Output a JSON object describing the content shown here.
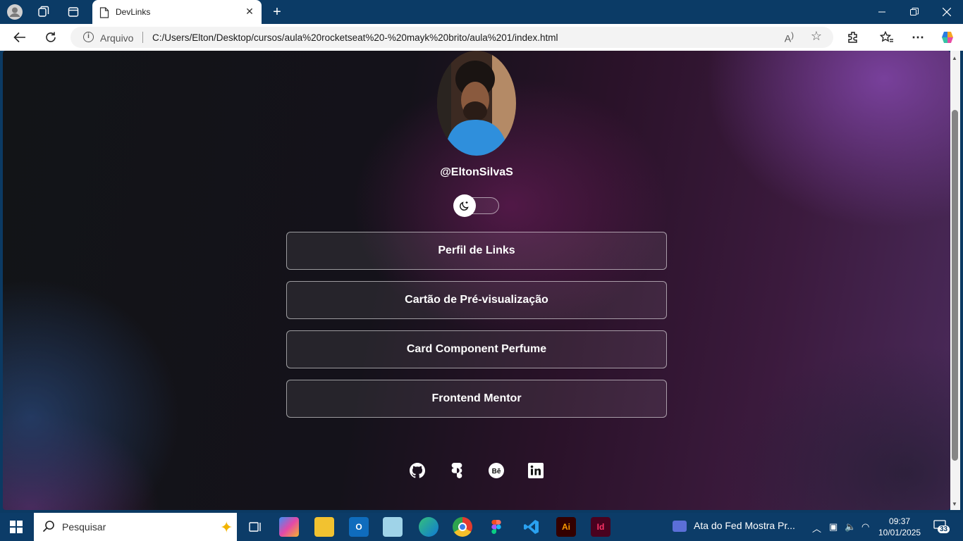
{
  "browser": {
    "tab_title": "DevLinks",
    "new_tab": "+",
    "address_prefix": "Arquivo",
    "url": "C:/Users/Elton/Desktop/cursos/aula%20rocketseat%20-%20mayk%20brito/aula%201/index.html"
  },
  "page": {
    "handle": "@EltonSilvaS",
    "links": [
      {
        "label": "Perfil de Links"
      },
      {
        "label": "Cartão de Pré-visualização"
      },
      {
        "label": "Card Component Perfume"
      },
      {
        "label": "Frontend Mentor"
      }
    ],
    "social_icons": [
      "github-icon",
      "figma-icon",
      "behance-icon",
      "linkedin-icon"
    ],
    "theme_toggle_icon": "moon-icon"
  },
  "taskbar": {
    "search_placeholder": "Pesquisar",
    "meeting_title": "Ata do Fed Mostra Pr...",
    "time": "09:37",
    "date": "10/01/2025",
    "notification_count": "33",
    "apps": [
      "copilot-icon",
      "task-view-icon",
      "file-explorer-icon",
      "outlook-icon",
      "notepad-icon",
      "edge-icon",
      "chrome-icon",
      "figma-icon",
      "vscode-icon",
      "illustrator-icon",
      "indesign-icon"
    ]
  },
  "colors": {
    "titlebar": "#0b3b66",
    "taskbar": "#0c3c68",
    "accent_purple": "#4a2a5a"
  }
}
